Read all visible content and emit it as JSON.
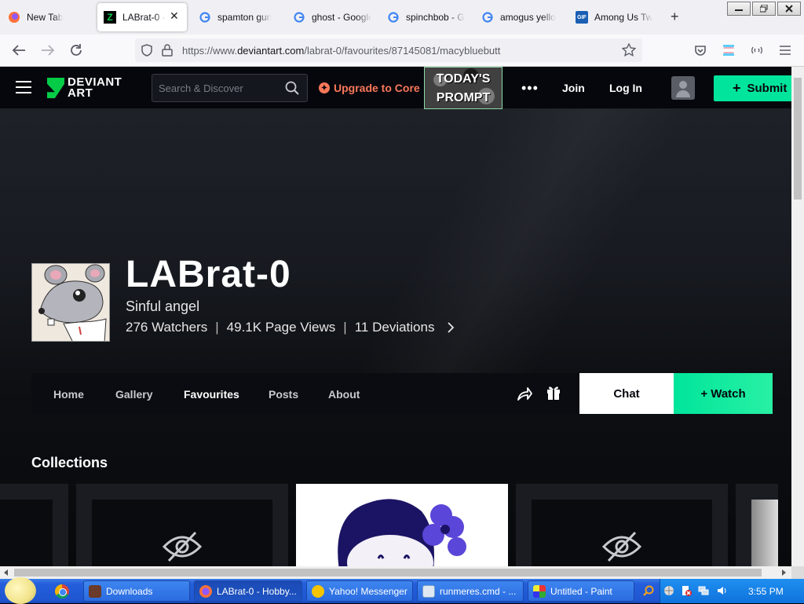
{
  "browser": {
    "tabs": [
      {
        "title": "New Tab",
        "icon": "firefox-icon"
      },
      {
        "title": "LABrat-0 - ",
        "icon": "deviantart-icon",
        "active": true
      },
      {
        "title": "spamton gun",
        "icon": "google-icon"
      },
      {
        "title": "ghost - Google",
        "icon": "google-icon"
      },
      {
        "title": "spinchbob - G",
        "icon": "google-icon"
      },
      {
        "title": "amogus yello",
        "icon": "google-icon"
      },
      {
        "title": "Among Us Tw",
        "icon": "gif-icon"
      }
    ],
    "close_glyph": "✕",
    "newtab_glyph": "+",
    "url_prefix": "https://www.",
    "url_host": "deviantart.com",
    "url_path": "/labrat-0/favourites/87145081/macybluebutt"
  },
  "header": {
    "logo_line1": "DEVIANT",
    "logo_line2": "ART",
    "search_placeholder": "Search & Discover",
    "upgrade_label": "Upgrade to Core",
    "prompt_line1": "TODAY'S",
    "prompt_line2": "PROMPT",
    "more_glyph": "•••",
    "join_label": "Join",
    "login_label": "Log In",
    "submit_label": "Submit",
    "accent_color": "#00e59b"
  },
  "profile": {
    "username": "LABrat-0",
    "tagline": "Sinful angel",
    "watchers": "276 Watchers",
    "page_views": "49.1K Page Views",
    "deviations": "11 Deviations",
    "separator": "|",
    "chevron": "›"
  },
  "profile_nav": {
    "tabs": [
      {
        "label": "Home"
      },
      {
        "label": "Gallery"
      },
      {
        "label": "Favourites",
        "active": true
      },
      {
        "label": "Posts"
      },
      {
        "label": "About"
      }
    ],
    "chat_label": "Chat",
    "watch_label": "+ Watch"
  },
  "collections": {
    "title": "Collections"
  },
  "taskbar": {
    "items": [
      {
        "label": "Downloads"
      },
      {
        "label": "LABrat-0 - Hobby..."
      },
      {
        "label": "Yahoo! Messenger"
      },
      {
        "label": "runmeres.cmd - ..."
      },
      {
        "label": "Untitled - Paint"
      }
    ],
    "clock": "3:55 PM"
  }
}
